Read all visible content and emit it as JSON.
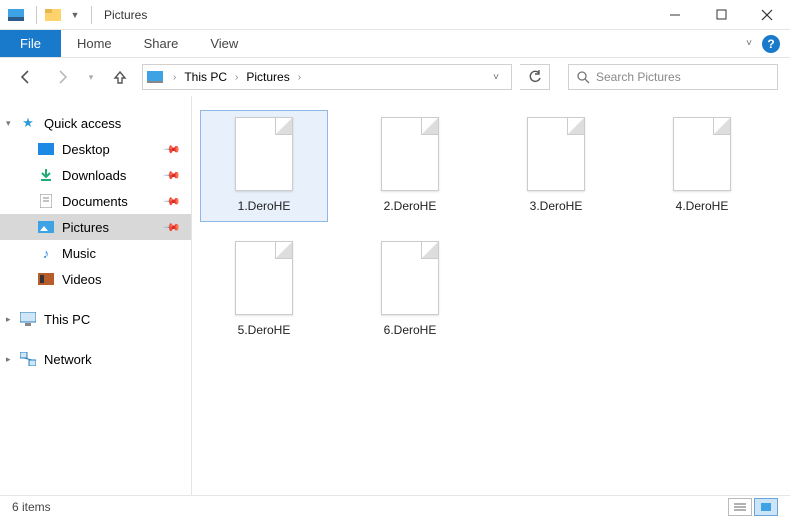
{
  "title": "Pictures",
  "ribbon": {
    "file": "File",
    "home": "Home",
    "share": "Share",
    "view": "View"
  },
  "breadcrumbs": {
    "root": "This PC",
    "folder": "Pictures"
  },
  "search": {
    "placeholder": "Search Pictures"
  },
  "sidebar": {
    "quick": "Quick access",
    "items": [
      {
        "label": "Desktop"
      },
      {
        "label": "Downloads"
      },
      {
        "label": "Documents"
      },
      {
        "label": "Pictures"
      },
      {
        "label": "Music"
      },
      {
        "label": "Videos"
      }
    ],
    "thispc": "This PC",
    "network": "Network"
  },
  "files": [
    {
      "name": "1.DeroHE"
    },
    {
      "name": "2.DeroHE"
    },
    {
      "name": "3.DeroHE"
    },
    {
      "name": "4.DeroHE"
    },
    {
      "name": "5.DeroHE"
    },
    {
      "name": "6.DeroHE"
    }
  ],
  "status": {
    "count": "6 items"
  }
}
